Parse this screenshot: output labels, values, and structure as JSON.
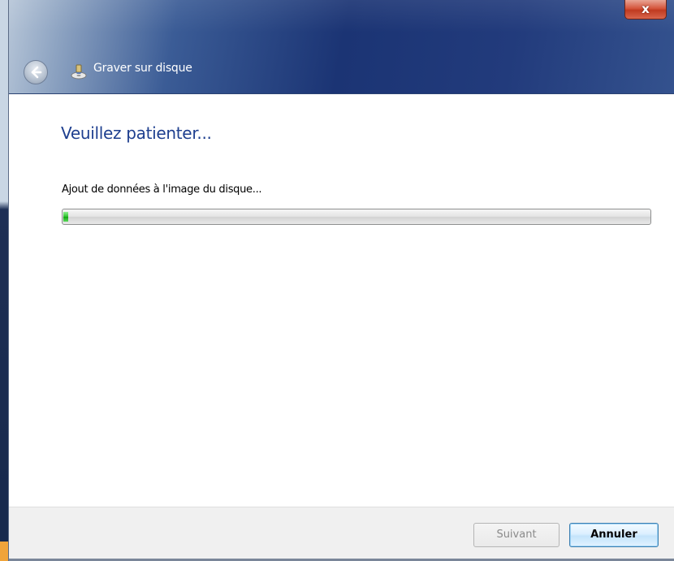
{
  "window": {
    "title": "Graver sur disque",
    "close_glyph": "x"
  },
  "content": {
    "heading": "Veuillez patienter...",
    "status": "Ajout de données à l'image du disque...",
    "progress_fraction": 0.008
  },
  "footer": {
    "next_label": "Suivant",
    "next_enabled": false,
    "cancel_label": "Annuler"
  },
  "icons": {
    "back": "back-arrow-icon",
    "app": "disc-burn-icon",
    "close": "close-icon"
  },
  "colors": {
    "heading": "#1e3f8f",
    "progress": "#2cc12c",
    "close": "#c03a20"
  }
}
